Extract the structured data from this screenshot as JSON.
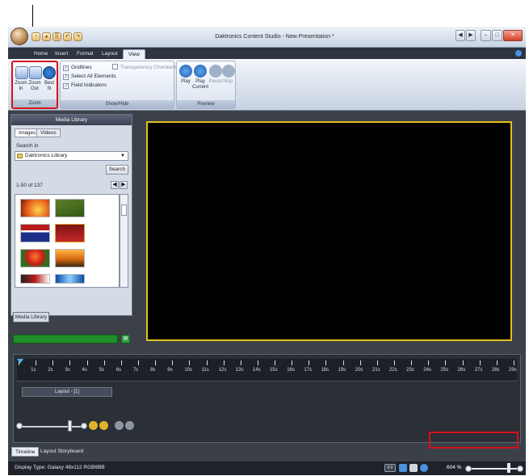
{
  "window": {
    "title": "Daktronics Content Studio - New Presentation *",
    "buttons": [
      "◀",
      "▶",
      "–",
      "□",
      "✕"
    ]
  },
  "quick_access": [
    "◔",
    "◕",
    "⎘",
    "↶",
    "↷"
  ],
  "ribbon_tabs": [
    "Home",
    "Insert",
    "Format",
    "Layout",
    "View"
  ],
  "ribbon": {
    "zoom": {
      "in_label": "Zoom In",
      "out_label": "Zoom Out",
      "best_label": "Best fit",
      "group": "Zoom"
    },
    "show_hide": {
      "gridlines": "Gridlines",
      "select_all": "Select All Elements",
      "field_indicators": "Field Indicators",
      "transparency": "Transparency Checkerboard",
      "group": "Show/Hide"
    },
    "preview": {
      "play": "Play",
      "play_current": "Play Current",
      "pause": "Pause",
      "stop": "Stop",
      "group": "Preview"
    }
  },
  "media_library": {
    "title": "Media Library",
    "tabs": [
      "Images",
      "Videos"
    ],
    "search_in_label": "Search in",
    "source": "Daktronics Library",
    "search_button": "Search",
    "range": "1-50 of 137",
    "footer_tab": "Media Library"
  },
  "timeline": {
    "marks": [
      "1s",
      "2s",
      "3s",
      "4s",
      "5s",
      "6s",
      "7s",
      "8s",
      "9s",
      "10s",
      "11s",
      "12s",
      "13s",
      "14s",
      "15s",
      "16s",
      "17s",
      "18s",
      "19s",
      "20s",
      "21s",
      "22s",
      "23s",
      "24s",
      "25s",
      "26s",
      "27s",
      "28s",
      "29s"
    ],
    "layer": "Layout - [1]"
  },
  "bottom_tabs": [
    "Timeline",
    "Layout Storyboard"
  ],
  "status": {
    "display_type": "Display Type: Galaxy 48x112 RGB6BB",
    "zoom": "604 %",
    "zoom_fit": "0:0"
  },
  "colors": {
    "canvas_border": "#e3c21a",
    "highlight": "#d6101a",
    "progress": "#1e8f2a"
  }
}
